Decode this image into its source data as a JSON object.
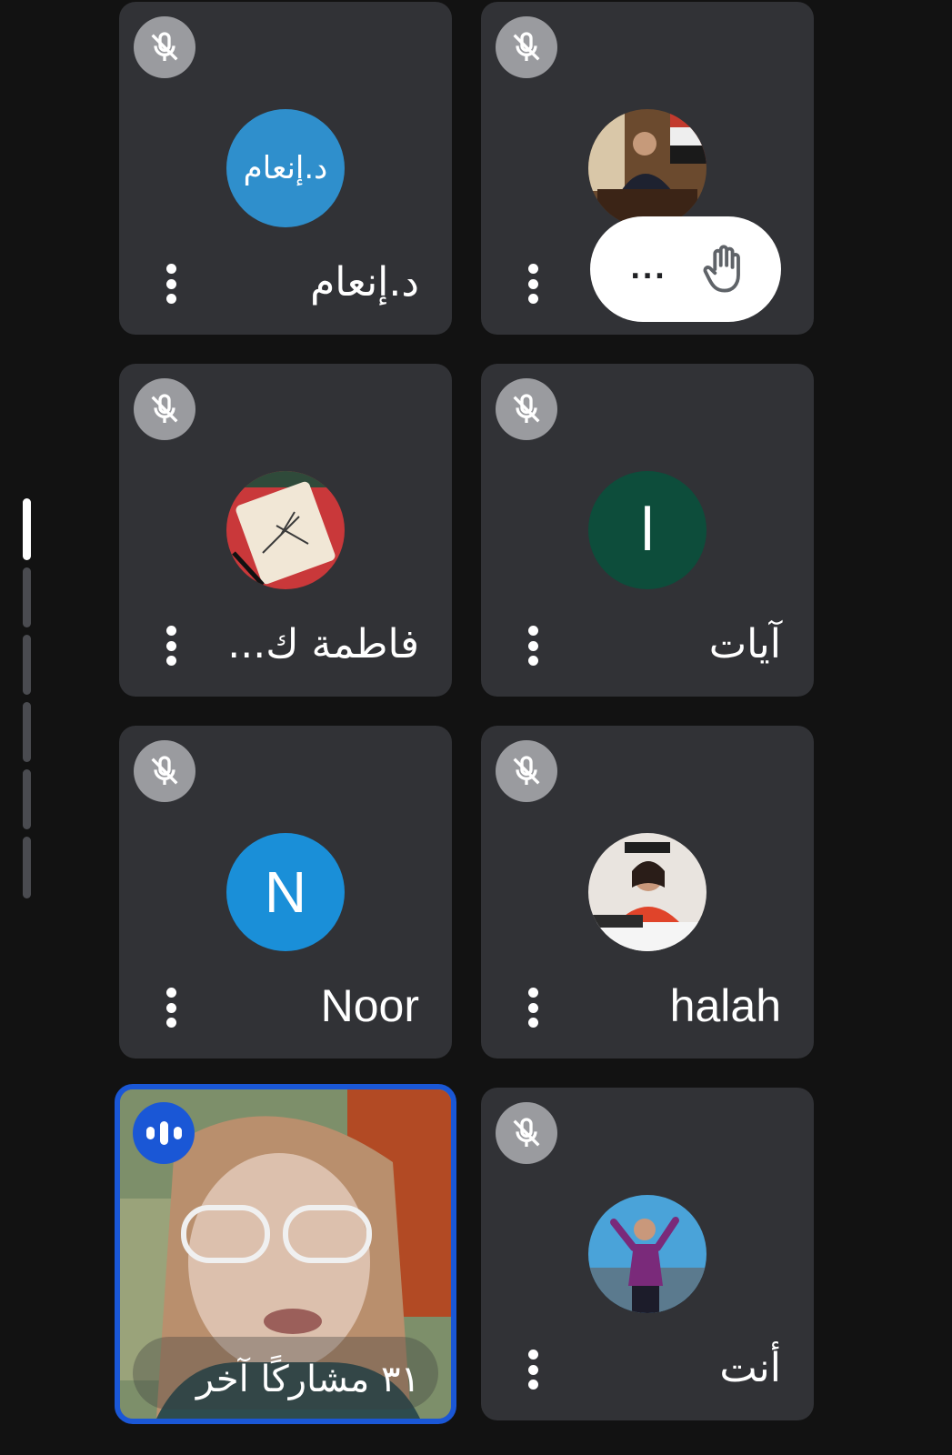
{
  "participants": [
    {
      "name": "د.إنعام",
      "avatar_text": "د.إنعام",
      "avatar_color": "#2f8fcc"
    },
    {
      "name": "",
      "hand_raised_label": "..."
    },
    {
      "name": "فاطمة ك..."
    },
    {
      "name": "آيات",
      "avatar_letter": "ا",
      "avatar_color": "#0d4d3b"
    },
    {
      "name": "Noor",
      "avatar_letter": "N",
      "avatar_color": "#1a8fd8"
    },
    {
      "name": "halah"
    },
    {
      "name": "أنت"
    }
  ],
  "others_label": "٣١ مشاركًا آخر",
  "colors": {
    "tile_bg": "#313236",
    "page_bg": "#121212",
    "active_border": "#1a57d6",
    "muted_badge": "#9a9b9f"
  },
  "icons": {
    "muted": "mic-off-icon",
    "speaking": "audio-level-icon",
    "more": "more-vert-icon",
    "hand": "raised-hand-icon"
  }
}
